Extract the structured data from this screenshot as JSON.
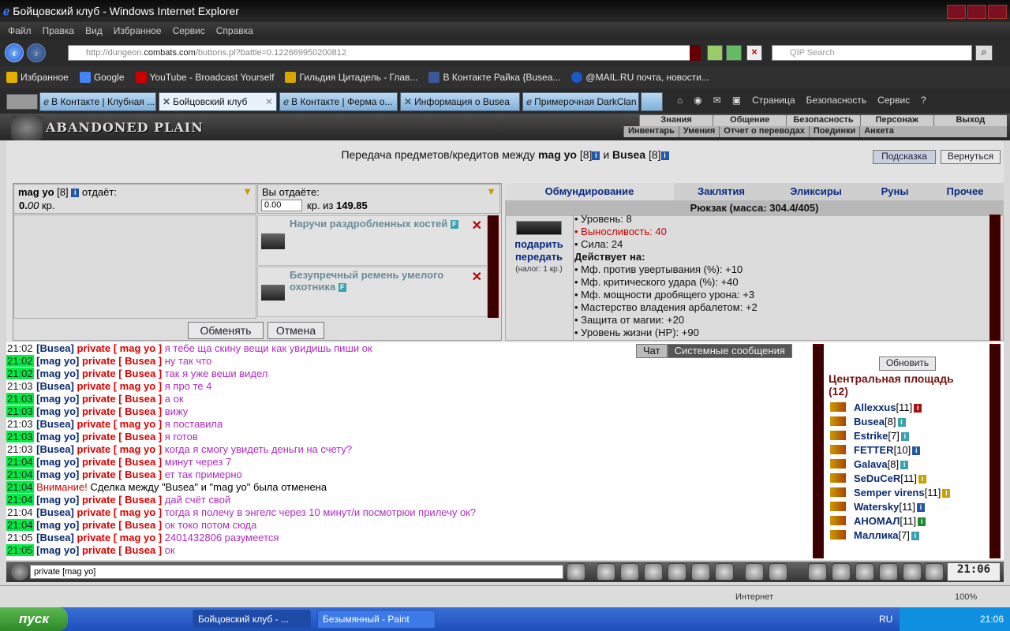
{
  "window": {
    "title": "Бойцовский клуб - Windows Internet Explorer"
  },
  "menu": [
    "Файл",
    "Правка",
    "Вид",
    "Избранное",
    "Сервис",
    "Справка"
  ],
  "address": {
    "prefix": "http://dungeon.",
    "domain": "combats.com",
    "suffix": "/buttons.pl?battle=0.122669950200812",
    "search_placeholder": "QIP Search"
  },
  "favorites": {
    "label": "Избранное",
    "items": [
      "Google",
      "YouTube - Broadcast Yourself",
      "Гильдия Цитадель - Глав...",
      "В Контакте  Райка {Busea...",
      "@MAIL.RU почта, новости..."
    ]
  },
  "tabs": [
    {
      "label": "В Контакте | Клубная ..."
    },
    {
      "label": "Бойцовский клуб"
    },
    {
      "label": "В Контакте | Ферма о..."
    },
    {
      "label": "Информация о Busea"
    },
    {
      "label": "Примерочная DarkClan"
    }
  ],
  "commandbar": [
    "Страница",
    "Безопасность",
    "Сервис"
  ],
  "game": {
    "logo": "ABANDONED PLAIN",
    "menu1": [
      "Знания",
      "Общение",
      "Безопасность",
      "Персонаж",
      "Выход"
    ],
    "menu2": [
      "Инвентарь",
      "Умения",
      "Отчет о переводах",
      "Поединки",
      "Анкета"
    ],
    "transfer": {
      "prefix": "Передача предметов/кредитов между",
      "u1": "mag yo",
      "l1": "[8]",
      "and": "и",
      "u2": "Busea",
      "l2": "[8]"
    },
    "help_button": "Подсказка",
    "back_button": "Вернуться",
    "left": {
      "name": "mag yo",
      "level": "[8]",
      "gives": "отдаёт:",
      "amount": "0.",
      "amount_dec": "00",
      "currency": "кр."
    },
    "you": {
      "label": "Вы отдаёте:",
      "input": "0.00",
      "of": "кр. из",
      "total": "149.85"
    },
    "items": [
      "Наручи раздробленных костей",
      "Безупречный ремень умелого охотника"
    ],
    "exchange_button": "Обменять",
    "cancel_button": "Отмена",
    "rtabs": [
      "Обмундирование",
      "Заклятия",
      "Эликсиры",
      "Руны",
      "Прочее"
    ],
    "backpack": "Рюкзак (масса: 304.4/405)",
    "gift": "подарить",
    "give": "передать",
    "tax": "(налог: 1 кр.)",
    "stats": {
      "level": "• Уровень: 8",
      "stamina": "• Выносливость: 40",
      "strength": "• Сила: 24",
      "acts": "Действует на:",
      "effects": [
        "• Мф. против увертывания (%): +10",
        "• Мф. критического удара (%): +40",
        "• Мф. мощности дробящего урона: +3",
        "• Мастерство владения арбалетом: +2",
        "• Защита от магии: +20",
        "• Уровень жизни (HP): +90"
      ]
    }
  },
  "chat": {
    "tabs": [
      "Чат",
      "Системные сообщения"
    ],
    "lines": [
      {
        "t": "21:02",
        "hl": false,
        "from": "[Busea]",
        "to": "private [ mag yo ]",
        "msg": "я тебе ща скину вещи как увидишь пиши ок"
      },
      {
        "t": "21:02",
        "hl": true,
        "from": "[mag yo]",
        "to": "private [ Busea ]",
        "msg": "ну так что"
      },
      {
        "t": "21:02",
        "hl": true,
        "from": "[mag yo]",
        "to": "private [ Busea ]",
        "msg": "так я уже веши видел"
      },
      {
        "t": "21:03",
        "hl": false,
        "from": "[Busea]",
        "to": "private [ mag yo ]",
        "msg": "я про те 4"
      },
      {
        "t": "21:03",
        "hl": true,
        "from": "[mag yo]",
        "to": "private [ Busea ]",
        "msg": "а ок"
      },
      {
        "t": "21:03",
        "hl": true,
        "from": "[mag yo]",
        "to": "private [ Busea ]",
        "msg": "вижу"
      },
      {
        "t": "21:03",
        "hl": false,
        "from": "[Busea]",
        "to": "private [ mag yo ]",
        "msg": "я поставила"
      },
      {
        "t": "21:03",
        "hl": true,
        "from": "[mag yo]",
        "to": "private [ Busea ]",
        "msg": "я готов"
      },
      {
        "t": "21:03",
        "hl": false,
        "from": "[Busea]",
        "to": "private [ mag yo ]",
        "msg": "когда я смогу увидеть деньги на счету?"
      },
      {
        "t": "21:04",
        "hl": true,
        "from": "[mag yo]",
        "to": "private [ Busea ]",
        "msg": "минут через 7"
      },
      {
        "t": "21:04",
        "hl": true,
        "from": "[mag yo]",
        "to": "private [ Busea ]",
        "msg": "ет так примерно"
      },
      {
        "t": "21:04",
        "hl": true,
        "warn": "Внимание!",
        "sys": "Сделка между \"Busea\" и \"mag yo\" была отменена"
      },
      {
        "t": "21:04",
        "hl": true,
        "from": "[mag yo]",
        "to": "private [ Busea ]",
        "msg": "дай счёт свой"
      },
      {
        "t": "21:04",
        "hl": false,
        "from": "[Busea]",
        "to": "private [ mag yo ]",
        "msg": "тогда я полечу в энгелс через 10 минут/и посмотрюи прилечу ок?"
      },
      {
        "t": "21:04",
        "hl": true,
        "from": "[mag yo]",
        "to": "private [ Busea ]",
        "msg": "ок токо потом сюда"
      },
      {
        "t": "21:05",
        "hl": false,
        "from": "[Busea]",
        "to": "private [ mag yo ]",
        "msg": "2401432806 разумеется"
      },
      {
        "t": "21:05",
        "hl": true,
        "from": "[mag yo]",
        "to": "private [ Busea ]",
        "msg": "ок"
      }
    ],
    "input": "private [mag yo]"
  },
  "online": {
    "refresh": "Обновить",
    "place": "Центральная площадь",
    "count": "(12)",
    "users": [
      {
        "n": "Allexxus",
        "l": "[11]",
        "c": "r"
      },
      {
        "n": "Busea",
        "l": "[8]",
        "c": "c"
      },
      {
        "n": "Estrike",
        "l": "[7]",
        "c": "c"
      },
      {
        "n": "FETTER",
        "l": "[10]",
        "c": ""
      },
      {
        "n": "Galava",
        "l": "[8]",
        "c": "c"
      },
      {
        "n": "SeDuCeR",
        "l": "[11]",
        "c": "y"
      },
      {
        "n": "Semper virens",
        "l": "[11]",
        "c": "y"
      },
      {
        "n": "Watersky",
        "l": "[11]",
        "c": ""
      },
      {
        "n": "АНОМАЛ",
        "l": "[11]",
        "c": "g"
      },
      {
        "n": "Маллика",
        "l": "[7]",
        "c": "c"
      }
    ]
  },
  "clock": "21:06",
  "status": {
    "zone": "Интернет",
    "zoom": "100%"
  },
  "taskbar": {
    "start": "пуск",
    "items": [
      "Бойцовский клуб - ...",
      "Безымянный - Paint"
    ],
    "lang": "RU",
    "time": "21:06"
  }
}
